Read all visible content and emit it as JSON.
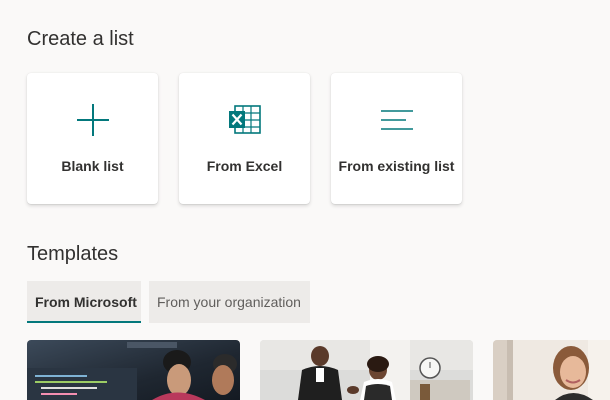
{
  "create": {
    "title": "Create a list",
    "cards": [
      {
        "label": "Blank list",
        "icon": "plus-icon"
      },
      {
        "label": "From Excel",
        "icon": "excel-icon"
      },
      {
        "label": "From existing list",
        "icon": "list-lines-icon"
      }
    ]
  },
  "templates": {
    "title": "Templates",
    "tabs": [
      {
        "label": "From Microsoft",
        "selected": true
      },
      {
        "label": "From your organization",
        "selected": false
      }
    ],
    "thumbnails": [
      {
        "icon": "template-thumbnail-coding-people"
      },
      {
        "icon": "template-thumbnail-business-handshake"
      },
      {
        "icon": "template-thumbnail-smiling-woman"
      }
    ]
  },
  "colors": {
    "accent": "#03787c",
    "background": "#faf9f8",
    "tab_background": "#edebe9",
    "text": "#323130"
  }
}
